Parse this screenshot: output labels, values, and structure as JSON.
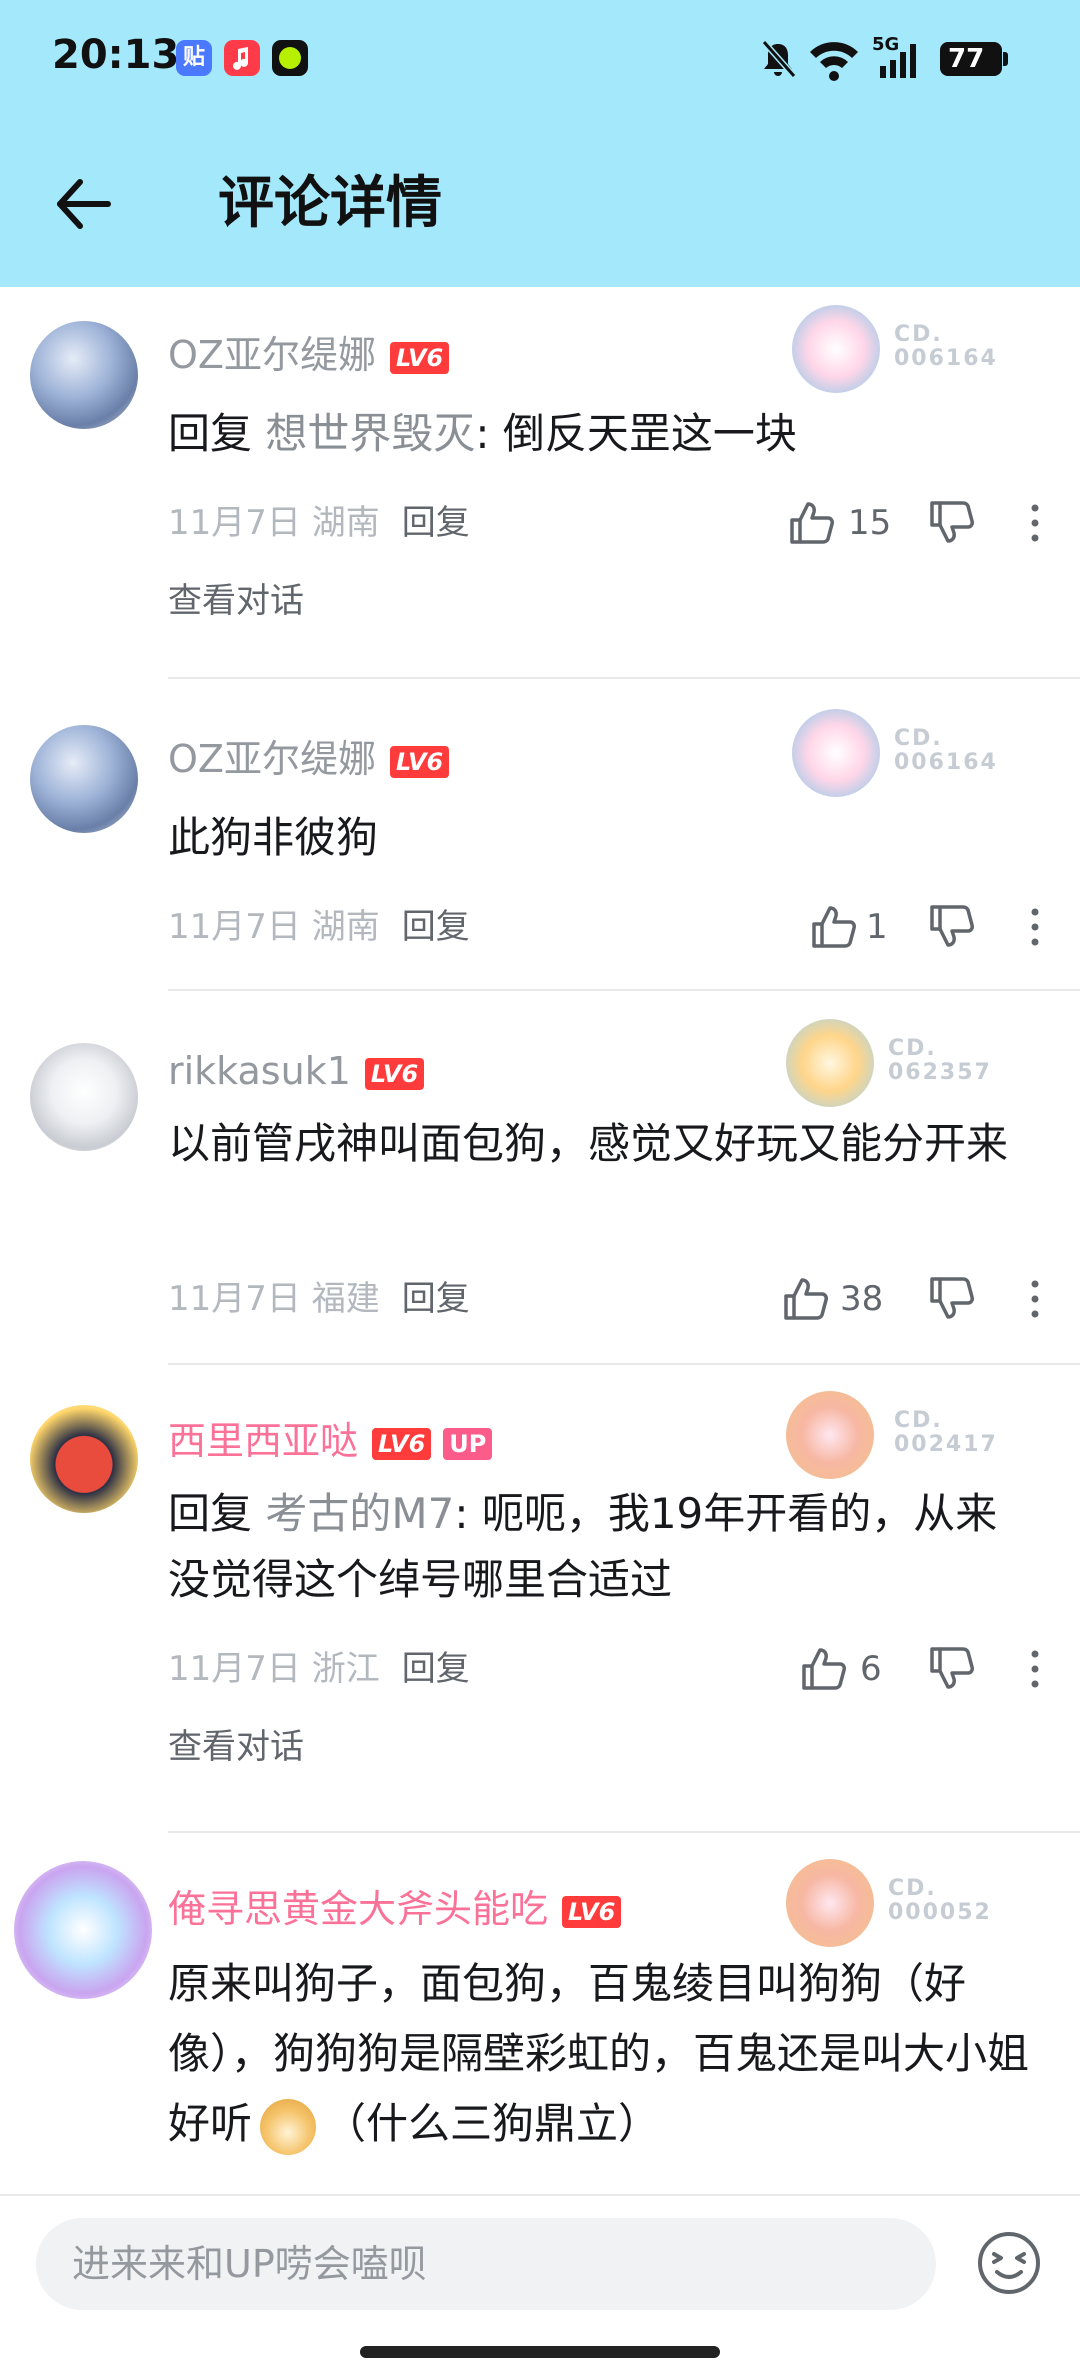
{
  "status_bar": {
    "time": "20:13",
    "battery": "77",
    "network": "5G"
  },
  "header": {
    "title": "评论详情"
  },
  "comments": [
    {
      "username": "OZ亚尔缇娜",
      "username_color": "#9499a0",
      "level": "LV6",
      "is_up": false,
      "medal_no_1": "CD.",
      "medal_no_2": "006164",
      "reply_prefix": "回复 ",
      "reply_to": "想世界毁灭",
      "text": ": 倒反天罡这一块",
      "date": "11月7日",
      "location": "湖南",
      "reply_label": "回复",
      "likes": "15",
      "view_conversation": "查看对话"
    },
    {
      "username": "OZ亚尔缇娜",
      "username_color": "#9499a0",
      "level": "LV6",
      "is_up": false,
      "medal_no_1": "CD.",
      "medal_no_2": "006164",
      "text": "此狗非彼狗",
      "date": "11月7日",
      "location": "湖南",
      "reply_label": "回复",
      "likes": "1"
    },
    {
      "username": "rikkasuk1",
      "username_color": "#9499a0",
      "level": "LV6",
      "is_up": false,
      "medal_no_1": "CD.",
      "medal_no_2": "062357",
      "text": "以前管戌神叫面包狗，感觉又好玩又能分开来",
      "date": "11月7日",
      "location": "福建",
      "reply_label": "回复",
      "likes": "38"
    },
    {
      "username": "西里西亚哒",
      "username_color": "#fb7299",
      "level": "LV6",
      "is_up": true,
      "up_label": "UP",
      "medal_no_1": "CD.",
      "medal_no_2": "002417",
      "reply_prefix": "回复 ",
      "reply_to": "考古的M7",
      "text": ": 呃呃，我19年开看的，从来没觉得这个绰号哪里合适过",
      "date": "11月7日",
      "location": "浙江",
      "reply_label": "回复",
      "likes": "6",
      "view_conversation": "查看对话"
    },
    {
      "username": "俺寻思黄金大斧头能吃",
      "username_color": "#fb7299",
      "level": "LV6",
      "is_up": false,
      "medal_no_1": "CD.",
      "medal_no_2": "000052",
      "text_a": "原来叫狗子，面包狗，百鬼绫目叫狗狗（好像），狗狗狗是隔壁彩虹的，百鬼还是叫大小姐好听",
      "text_b": "（什么三狗鼎立）"
    }
  ],
  "bottom_bar": {
    "input_placeholder": "进来来和UP唠会嗑呗"
  },
  "colors": {
    "header_bg": "#a4e9fb",
    "level_badge": "#ff3b3b",
    "up_badge": "#fb5c8a",
    "vip_name": "#fb7299"
  }
}
